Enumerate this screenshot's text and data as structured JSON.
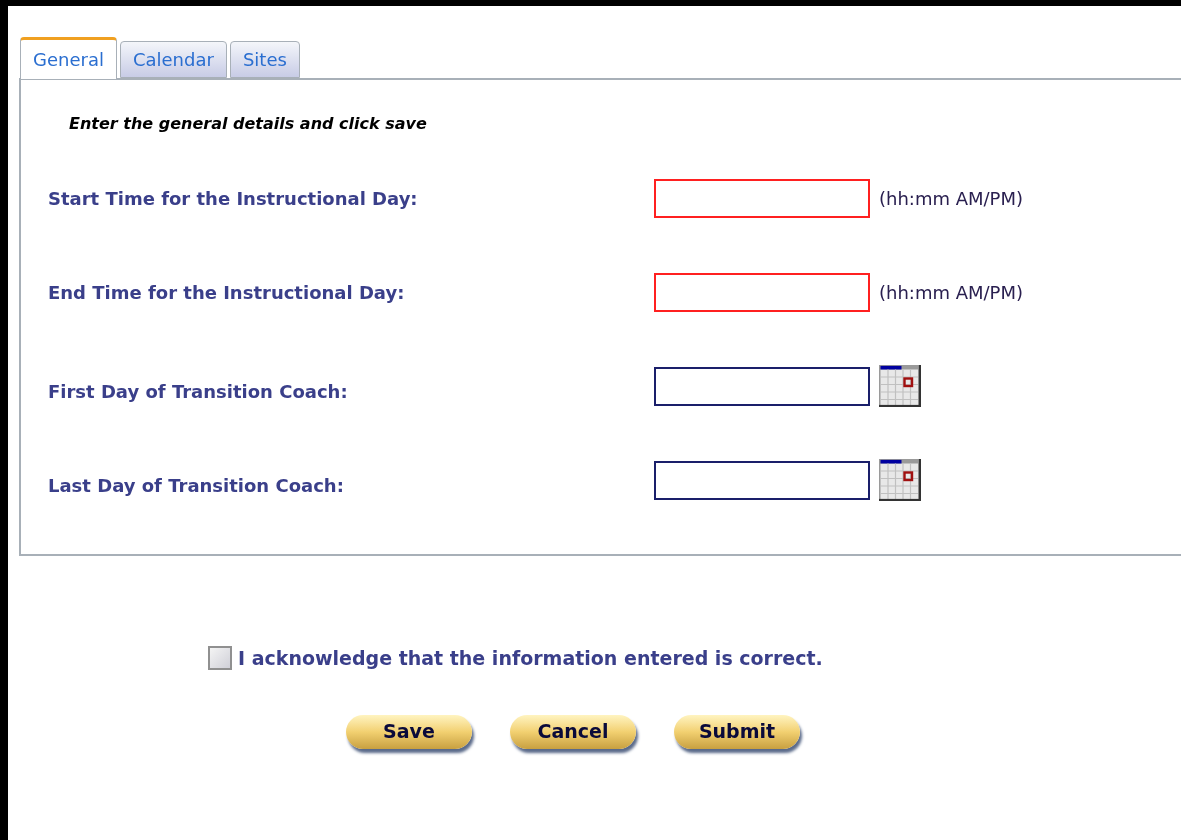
{
  "tabs": [
    {
      "label": "General",
      "selected": true
    },
    {
      "label": "Calendar",
      "selected": false
    },
    {
      "label": "Sites",
      "selected": false
    }
  ],
  "instructions": "Enter the general details and click save",
  "fields": [
    {
      "label": "Start Time for the Instructional Day:",
      "kind": "time",
      "invalid": true,
      "hint": "(hh:mm AM/PM)"
    },
    {
      "label": "End Time for the Instructional Day:",
      "kind": "time",
      "invalid": true,
      "hint": "(hh:mm AM/PM)"
    },
    {
      "label": "First Day of Transition Coach:",
      "kind": "date",
      "invalid": false
    },
    {
      "label": "Last Day of Transition Coach:",
      "kind": "date",
      "invalid": false
    }
  ],
  "acknowledge": {
    "label": "I acknowledge that the information entered is correct.",
    "checked": false
  },
  "buttons": [
    "Save",
    "Cancel",
    "Submit"
  ]
}
